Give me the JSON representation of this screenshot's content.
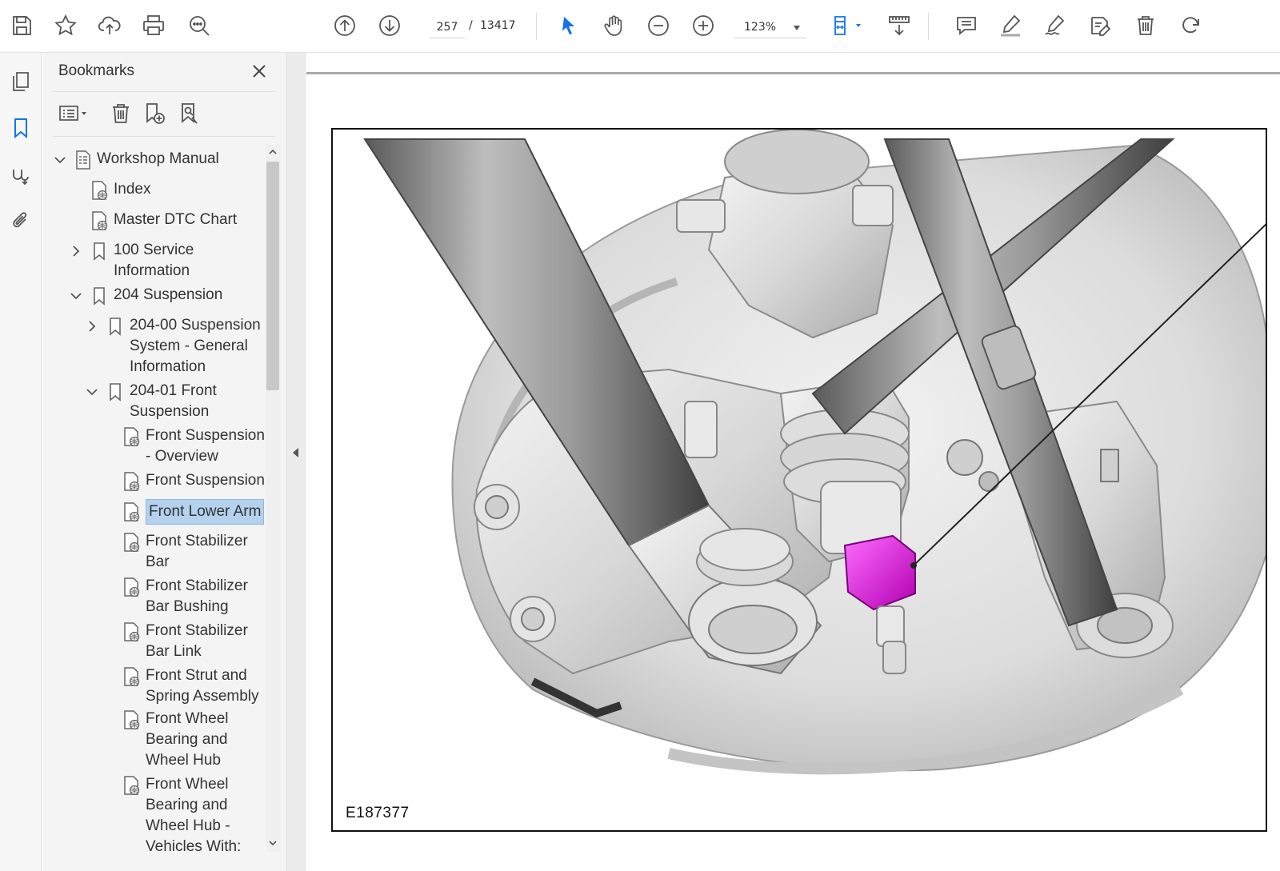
{
  "toolbar": {
    "page_current": "257",
    "page_separator": "/",
    "page_total": "13417",
    "zoom": "123%",
    "accent_color": "#1473e6"
  },
  "panel": {
    "title": "Bookmarks"
  },
  "bookmarks": [
    {
      "label_lines": [
        "Workshop Manual"
      ],
      "icon": "document-tree-icon",
      "expanded": true
    },
    {
      "label_lines": [
        "Index"
      ],
      "icon": "web-page-icon"
    },
    {
      "label_lines": [
        "Master DTC Chart"
      ],
      "icon": "web-page-icon"
    },
    {
      "label_lines": [
        "100 Service",
        "Information"
      ],
      "icon": "bookmark-icon",
      "expanded": false
    },
    {
      "label_lines": [
        "204 Suspension"
      ],
      "icon": "bookmark-icon",
      "expanded": true
    },
    {
      "label_lines": [
        "204-00 Suspension",
        "System - General",
        "Information"
      ],
      "icon": "bookmark-icon",
      "expanded": false
    },
    {
      "label_lines": [
        "204-01 Front",
        "Suspension"
      ],
      "icon": "bookmark-icon",
      "expanded": true
    },
    {
      "label_lines": [
        "Front Suspension",
        "- Overview"
      ],
      "icon": "web-page-icon"
    },
    {
      "label_lines": [
        "Front Suspension"
      ],
      "icon": "web-page-icon"
    },
    {
      "label_lines": [
        "Front Lower Arm"
      ],
      "icon": "web-page-icon",
      "selected": true
    },
    {
      "label_lines": [
        "Front Stabilizer",
        "Bar"
      ],
      "icon": "web-page-icon"
    },
    {
      "label_lines": [
        "Front Stabilizer",
        "Bar Bushing"
      ],
      "icon": "web-page-icon"
    },
    {
      "label_lines": [
        "Front Stabilizer",
        "Bar Link"
      ],
      "icon": "web-page-icon"
    },
    {
      "label_lines": [
        "Front Strut and",
        "Spring Assembly"
      ],
      "icon": "web-page-icon"
    },
    {
      "label_lines": [
        "Front Wheel",
        "Bearing and",
        "Wheel Hub"
      ],
      "icon": "web-page-icon"
    },
    {
      "label_lines": [
        "Front Wheel",
        "Bearing and",
        "Wheel Hub -",
        "Vehicles With:"
      ],
      "icon": "web-page-icon"
    }
  ],
  "document": {
    "figure_code": "E187377",
    "highlight_color": "#e000e0"
  }
}
